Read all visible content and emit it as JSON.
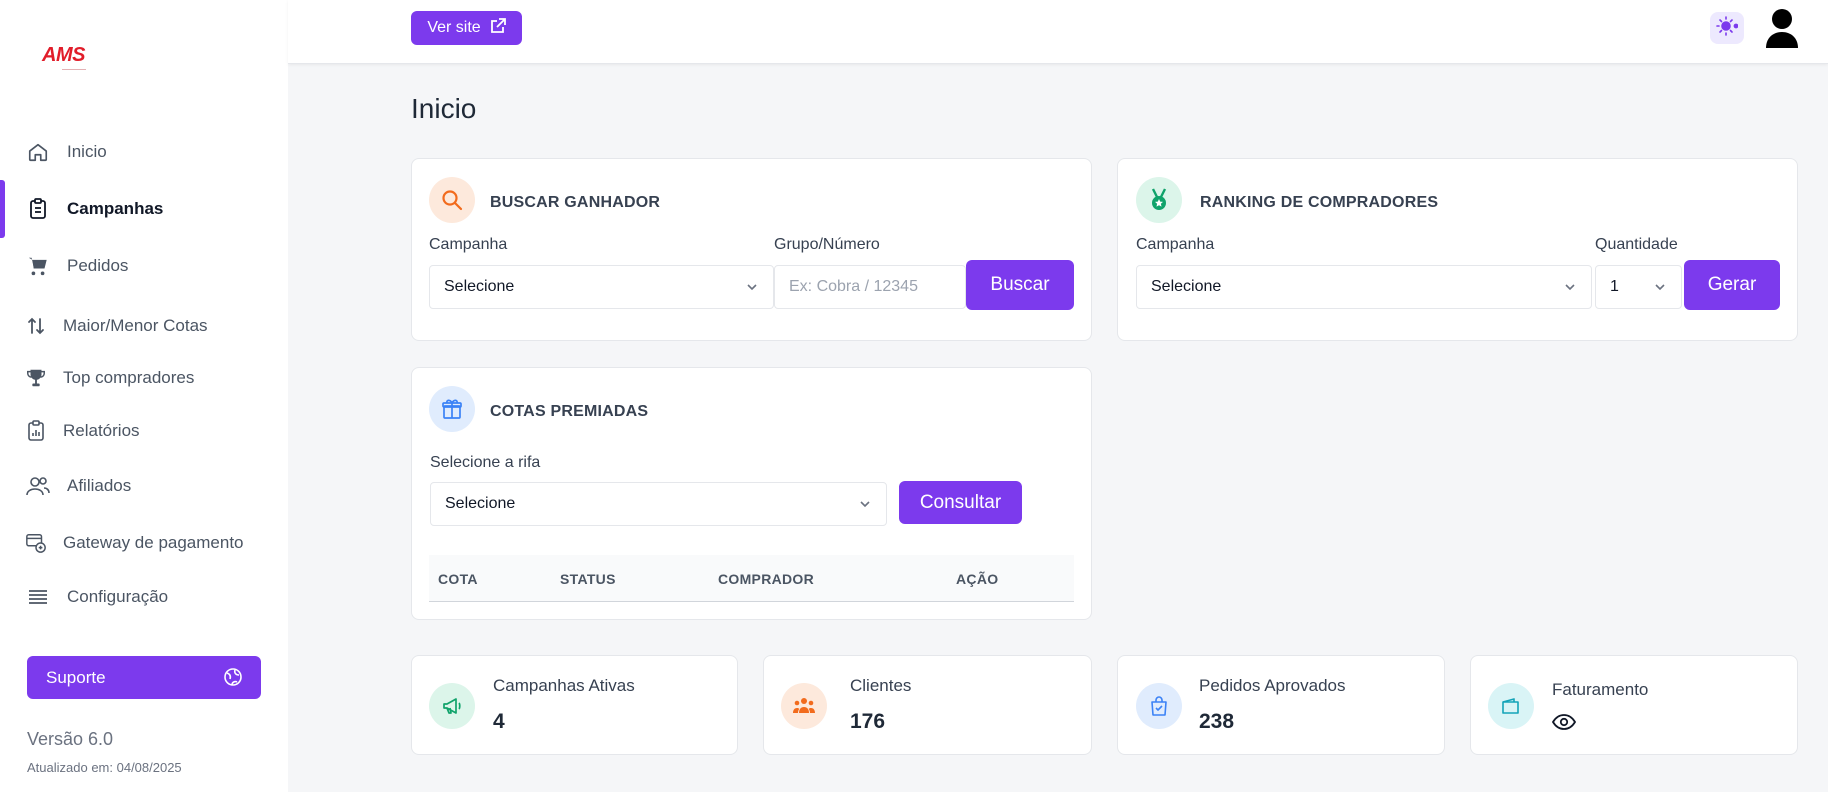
{
  "brand": {
    "logo_text": "AMS",
    "accent": "#7c3aed",
    "logo_color": "#e11d2a"
  },
  "sidebar": {
    "items": [
      {
        "label": "Inicio",
        "icon": "home-icon"
      },
      {
        "label": "Campanhas",
        "icon": "clipboard-icon",
        "active": true
      },
      {
        "label": "Pedidos",
        "icon": "cart-icon"
      },
      {
        "label": "Maior/Menor Cotas",
        "icon": "sort-arrows-icon"
      },
      {
        "label": "Top compradores",
        "icon": "trophy-icon"
      },
      {
        "label": "Relatórios",
        "icon": "report-icon"
      },
      {
        "label": "Afiliados",
        "icon": "users-icon"
      },
      {
        "label": "Gateway de pagamento",
        "icon": "payment-gateway-icon"
      },
      {
        "label": "Configuração",
        "icon": "menu-lines-icon"
      }
    ],
    "support_label": "Suporte",
    "version": "Versão 6.0",
    "updated": "Atualizado em: 04/08/2025"
  },
  "topbar": {
    "ver_site_label": "Ver site"
  },
  "page": {
    "title": "Inicio"
  },
  "buscar_ganhador": {
    "title": "BUSCAR GANHADOR",
    "campanha_label": "Campanha",
    "campanha_value": "Selecione",
    "grupo_label": "Grupo/Número",
    "grupo_placeholder": "Ex: Cobra / 12345",
    "button": "Buscar"
  },
  "ranking": {
    "title": "RANKING DE COMPRADORES",
    "campanha_label": "Campanha",
    "campanha_value": "Selecione",
    "quantidade_label": "Quantidade",
    "quantidade_value": "1",
    "button": "Gerar"
  },
  "cotas": {
    "title": "COTAS PREMIADAS",
    "rifa_label": "Selecione a rifa",
    "rifa_value": "Selecione",
    "button": "Consultar",
    "columns": [
      "COTA",
      "STATUS",
      "COMPRADOR",
      "AÇÃO"
    ]
  },
  "stats": [
    {
      "label": "Campanhas Ativas",
      "value": "4"
    },
    {
      "label": "Clientes",
      "value": "176"
    },
    {
      "label": "Pedidos Aprovados",
      "value": "238"
    },
    {
      "label": "Faturamento",
      "value": ""
    }
  ]
}
